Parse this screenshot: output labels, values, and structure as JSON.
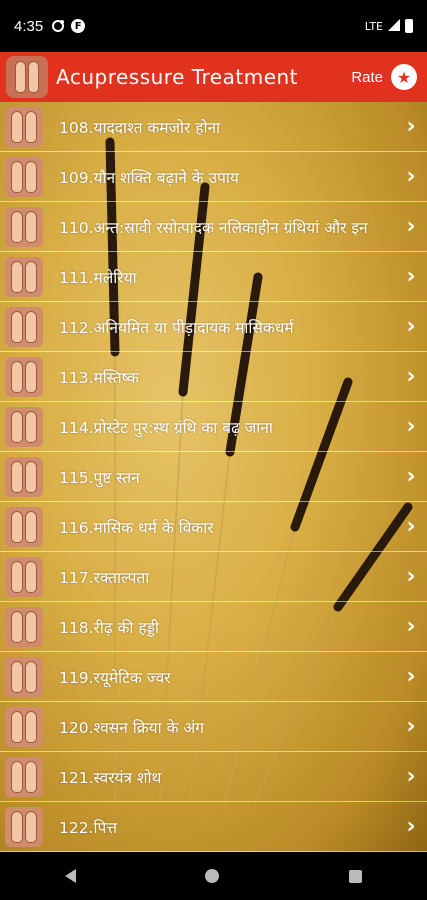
{
  "status_bar": {
    "time": "4:35",
    "network": "LTE"
  },
  "app_bar": {
    "title": "Acupressure Treatment",
    "rate_label": "Rate"
  },
  "list": {
    "items": [
      {
        "label": "108.याददाश्त कमजोर होना"
      },
      {
        "label": "109.यौन शक्ति बढ़ाने के उपाय"
      },
      {
        "label": "110.अन्त:स्रावी रसोत्पादक नलिकाहीन ग्रंथियां और इन"
      },
      {
        "label": "111.मलेरिया"
      },
      {
        "label": "112.अनियमित या पीड़ादायक मासिकधर्म"
      },
      {
        "label": "113.मस्तिष्क"
      },
      {
        "label": "114.प्रोस्टेट पुर:स्थ ग्रंथि का बढ़ जाना"
      },
      {
        "label": "115.पुष्ट स्तन"
      },
      {
        "label": "116.मासिक धर्म के विकार"
      },
      {
        "label": "117.रक्ताल्पता"
      },
      {
        "label": "118.रीढ़ की हड्डी"
      },
      {
        "label": "119.रयूमेटिक ज्वर"
      },
      {
        "label": "120.श्वसन क्रिया के अंग"
      },
      {
        "label": "121.स्वरयंत्र शोथ"
      },
      {
        "label": "122.पित्त"
      }
    ]
  },
  "colors": {
    "app_bar": "#e1321e",
    "list_background": "#d9ae45"
  },
  "icons": {
    "chevron": "chevron-right-icon",
    "rate": "star-icon",
    "logo": "feet-logo-icon"
  }
}
